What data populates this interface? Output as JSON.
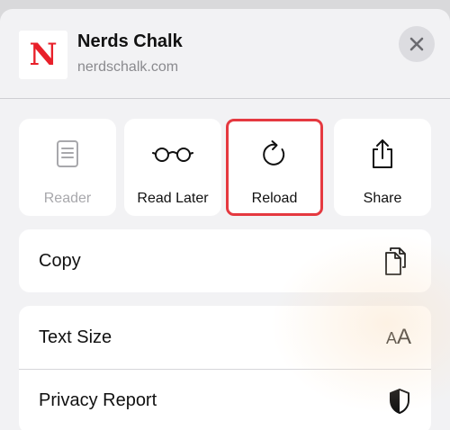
{
  "header": {
    "favicon_letter": "N",
    "title": "Nerds Chalk",
    "url": "nerdschalk.com",
    "close_icon": "close-x-icon"
  },
  "actions": [
    {
      "label": "Reader",
      "icon": "reader-doc-icon",
      "enabled": false
    },
    {
      "label": "Read Later",
      "icon": "glasses-icon",
      "enabled": true
    },
    {
      "label": "Reload",
      "icon": "reload-icon",
      "enabled": true,
      "highlighted": true
    },
    {
      "label": "Share",
      "icon": "share-icon",
      "enabled": true
    }
  ],
  "menu": {
    "copy": {
      "label": "Copy",
      "icon": "copy-icon"
    },
    "text_size": {
      "label": "Text Size",
      "icon_small": "A",
      "icon_large": "A"
    },
    "privacy_report": {
      "label": "Privacy Report",
      "icon": "shield-icon"
    }
  },
  "colors": {
    "brand_red": "#e8202a",
    "highlight_red": "#e53940",
    "sheet_bg": "#f2f2f4"
  }
}
